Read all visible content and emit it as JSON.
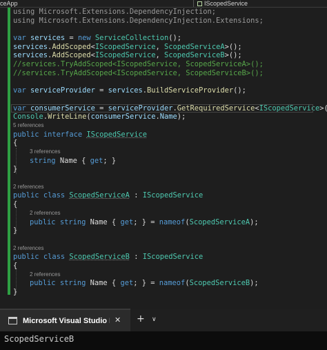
{
  "navbar": {
    "project": "ceApp",
    "member": "IScopedService"
  },
  "code": {
    "l1": [
      "using",
      "Microsoft.Extensions.DependencyInjection;"
    ],
    "l2": [
      "using",
      "Microsoft.Extensions.DependencyInjection.Extensions;"
    ],
    "l4": [
      "var",
      "services",
      " = ",
      "new",
      "ServiceCollection",
      "();"
    ],
    "l5": [
      "services",
      ".",
      "AddScoped",
      "<",
      "IScopedService",
      ", ",
      "ScopedServiceA",
      ">();"
    ],
    "l6": [
      "services",
      ".",
      "AddScoped",
      "<",
      "IScopedService",
      ", ",
      "ScopedServiceB",
      ">();"
    ],
    "l7": "//services.TryAddScoped<IScopedService, ScopedServiceA>();",
    "l8": "//services.TryAddScoped<IScopedService, ScopedServiceB>();",
    "l10": [
      "var",
      "serviceProvider",
      " = ",
      "services",
      ".",
      "BuildServiceProvider",
      "();"
    ],
    "l12": [
      "var",
      "consumerService",
      " = ",
      "serviceProvider",
      ".",
      "GetRequiredService",
      "<",
      "IScopedService",
      ">();"
    ],
    "l13": [
      "Console",
      ".",
      "WriteLine",
      "(",
      "consumerService",
      ".",
      "Name",
      ");"
    ],
    "cl_interface": "5 references",
    "l14": [
      "public",
      "interface",
      "IScopedService"
    ],
    "cl_name": "3 references",
    "l16": [
      "string",
      "Name",
      " { ",
      "get",
      "; }"
    ],
    "cl_a": "2 references",
    "l19": [
      "public",
      "class",
      "ScopedServiceA",
      " : ",
      "IScopedService"
    ],
    "cl_a_name": "2 references",
    "l21": [
      "public",
      "string",
      "Name",
      " { ",
      "get",
      "; } = ",
      "nameof",
      "(",
      "ScopedServiceA",
      ");"
    ],
    "cl_b": "2 references",
    "l24": [
      "public",
      "class",
      "ScopedServiceB",
      " : ",
      "IScopedService"
    ],
    "cl_b_name": "2 references",
    "l26": [
      "public",
      "string",
      "Name",
      " { ",
      "get",
      "; } = ",
      "nameof",
      "(",
      "ScopedServiceB",
      ");"
    ],
    "open_brace": "{",
    "close_brace": "}"
  },
  "terminal": {
    "tab_title": "Microsoft Visual Studio Debug Console",
    "close_glyph": "✕",
    "add_glyph": "+",
    "dropdown_glyph": "∨",
    "output": "ScopedServiceB"
  },
  "icons": {
    "terminal": "terminal-icon",
    "member": "interface-member-icon"
  },
  "colors": {
    "keyword": "#569cd6",
    "type": "#4ec9b0",
    "method": "#dcdcaa",
    "variable": "#9cdcfe",
    "comment": "#57a64a",
    "change_bar": "#2ea043"
  }
}
